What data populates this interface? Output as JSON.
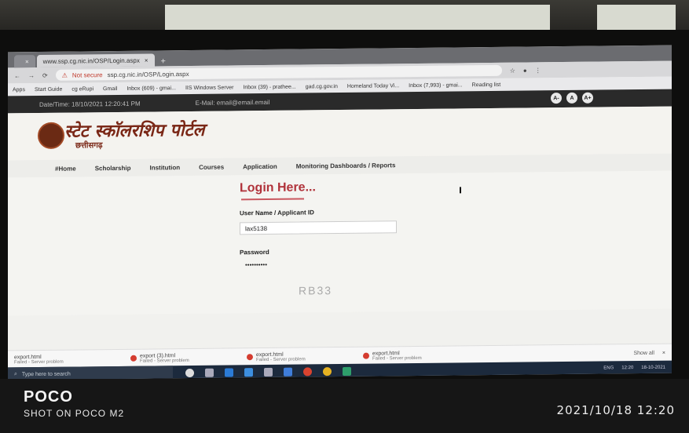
{
  "browser": {
    "tabs": [
      {
        "label": ""
      },
      {
        "label": "www.ssp.cg.nic.in/OSP/Login.aspx",
        "active": true
      }
    ],
    "new_tab_label": "+",
    "address": {
      "security_label": "Not secure",
      "url": "ssp.cg.nic.in/OSP/Login.aspx"
    },
    "bookmarks": [
      "Apps",
      "Start Guide",
      "cg eRupi",
      "Gmail",
      "Inbox (609) - gmai...",
      "IIS Windows Server",
      "Inbox (39) - prathee...",
      "gad.cg.gov.in",
      "Homeland Today Vi...",
      "Inbox (7,993) - gmai...",
      "Reading list"
    ]
  },
  "site": {
    "topstrip": {
      "datetime": "Date/Time: 18/10/2021 12:20:41 PM",
      "email": "E-Mail: email@email.email"
    },
    "font_buttons": [
      "A-",
      "A",
      "A+"
    ],
    "title": "स्टेट स्कॉलरशिप पोर्टल",
    "subtitle": "छत्तीसगढ़",
    "nav": [
      "#Home",
      "Scholarship",
      "Institution",
      "Courses",
      "Application",
      "Monitoring Dashboards / Reports"
    ],
    "login": {
      "heading": "Login Here...",
      "username_label": "User Name / Applicant ID",
      "username_value": "lax5138",
      "password_label": "Password",
      "password_value": "••••••••••"
    },
    "watermark": "RB33"
  },
  "downloads": [
    {
      "name": "export.html",
      "status": "Failed - Server problem"
    },
    {
      "name": "export (3).html",
      "status": "Failed - Server problem"
    },
    {
      "name": "export.html",
      "status": "Failed - Server problem"
    },
    {
      "name": "export.html",
      "status": "Failed - Server problem"
    }
  ],
  "downloads_show_all": "Show all",
  "taskbar": {
    "search_placeholder": "Type here to search",
    "tray_lang": "ENG",
    "tray_time": "12:20",
    "tray_date": "18-10-2021"
  },
  "camera": {
    "brand": "POCO",
    "shot_on": "SHOT ON POCO M2",
    "timestamp": "2021/10/18  12:20"
  }
}
